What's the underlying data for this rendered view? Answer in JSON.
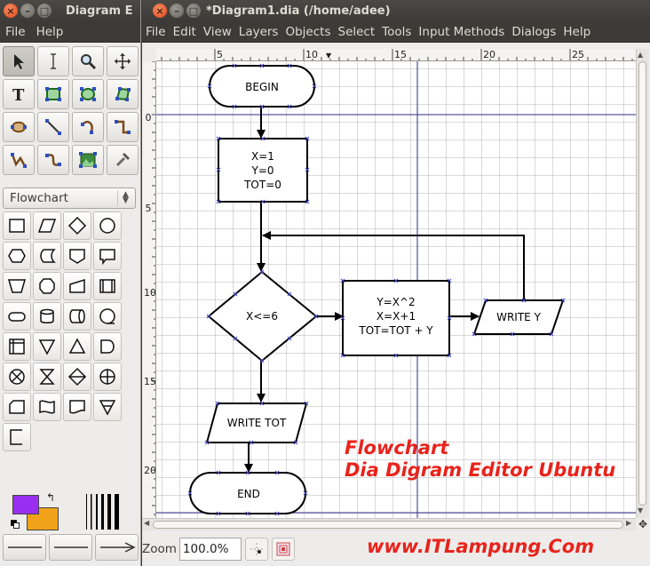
{
  "toolbox": {
    "title": "Diagram E",
    "menu": [
      "File",
      "Help"
    ],
    "sheet": "Flowchart"
  },
  "diagram": {
    "title": "*Diagram1.dia (/home/adee)",
    "menu": [
      "File",
      "Edit",
      "View",
      "Layers",
      "Objects",
      "Select",
      "Tools",
      "Input Methods",
      "Dialogs",
      "Help"
    ],
    "hruler_labels": [
      "5",
      "10",
      "15",
      "20",
      "25"
    ],
    "vruler_labels": [
      "0",
      "5",
      "10",
      "15",
      "20"
    ],
    "zoom_label": "Zoom",
    "zoom_value": "100.0%"
  },
  "flowchart": {
    "begin": "BEGIN",
    "init_1": "X=1",
    "init_2": "Y=0",
    "init_3": "TOT=0",
    "decision": "X<=6",
    "process_1": "Y=X^2",
    "process_2": "X=X+1",
    "process_3": "TOT=TOT + Y",
    "write_y": "WRITE Y",
    "write_tot": "WRITE TOT",
    "end": "END"
  },
  "watermark": {
    "line1": "Flowchart",
    "line2": "Dia Digram Editor Ubuntu",
    "site": "www.ITLampung.Com"
  },
  "colors": {
    "foreground": "#9a2ef0",
    "background": "#f2a21a",
    "guide": "#2d2d8c",
    "watermark": "#e8231b"
  }
}
